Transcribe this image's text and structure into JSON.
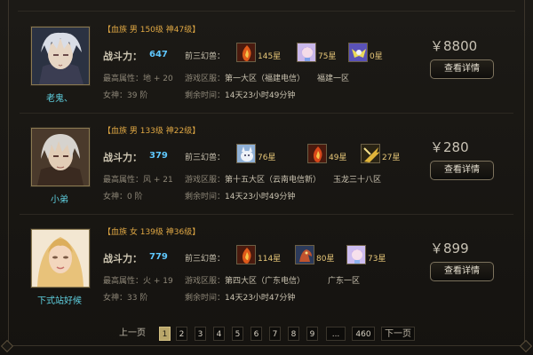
{
  "listings": [
    {
      "nickname": "老鬼、",
      "tag": "【血族 男 150级 神47级】",
      "power_label": "战斗力：",
      "power": "647",
      "attr_label": "最高属性：",
      "attr_value": "地 + 20",
      "level_label": "女神：",
      "level_value": "39 阶",
      "pets_label": "前三幻兽：",
      "pets": [
        {
          "icon": "fire-beast-icon",
          "stars": "145星"
        },
        {
          "icon": "spirit-girl-icon",
          "stars": "75星"
        },
        {
          "icon": "wing-sprite-icon",
          "stars": "0星"
        }
      ],
      "server_label": "游戏区服：",
      "server": "第一大区（福建电信）",
      "server_sub": "福建一区",
      "time_label": "剩余时间：",
      "time": "14天23小时49分钟",
      "price": "￥8800",
      "detail": "查看详情"
    },
    {
      "nickname": "小弟",
      "tag": "【血族 男 133级 神22级】",
      "power_label": "战斗力：",
      "power": "379",
      "attr_label": "最高属性：",
      "attr_value": "风 + 21",
      "level_label": "女神：",
      "level_value": "0 阶",
      "pets_label": "前三幻兽：",
      "pets": [
        {
          "icon": "white-beast-icon",
          "stars": "76星"
        },
        {
          "icon": "fire-beast-icon",
          "stars": "49星"
        },
        {
          "icon": "blade-beast-icon",
          "stars": "27星"
        }
      ],
      "server_label": "游戏区服：",
      "server": "第十五大区（云南电信新）",
      "server_sub": "玉龙三十八区",
      "time_label": "剩余时间：",
      "time": "14天23小时49分钟",
      "price": "￥280",
      "detail": "查看详情"
    },
    {
      "nickname": "下式站好候",
      "tag": "【血族 女 139级 神36级】",
      "power_label": "战斗力：",
      "power": "779",
      "attr_label": "最高属性：",
      "attr_value": "火 + 19",
      "level_label": "女神：",
      "level_value": "33 阶",
      "pets_label": "前三幻兽：",
      "pets": [
        {
          "icon": "fire-beast-icon",
          "stars": "114星"
        },
        {
          "icon": "dragon-beast-icon",
          "stars": "80星"
        },
        {
          "icon": "spirit-girl-icon",
          "stars": "73星"
        }
      ],
      "server_label": "游戏区服：",
      "server": "第四大区（广东电信）",
      "server_sub": "广东一区",
      "time_label": "剩余时间：",
      "time": "14天23小时47分钟",
      "price": "￥899",
      "detail": "查看详情"
    }
  ],
  "pagination": {
    "prev": "上一页",
    "pages": [
      "1",
      "2",
      "3",
      "4",
      "5",
      "6",
      "7",
      "8",
      "9"
    ],
    "active": "1",
    "ellipsis": "...",
    "last": "460",
    "next": "下一页"
  }
}
